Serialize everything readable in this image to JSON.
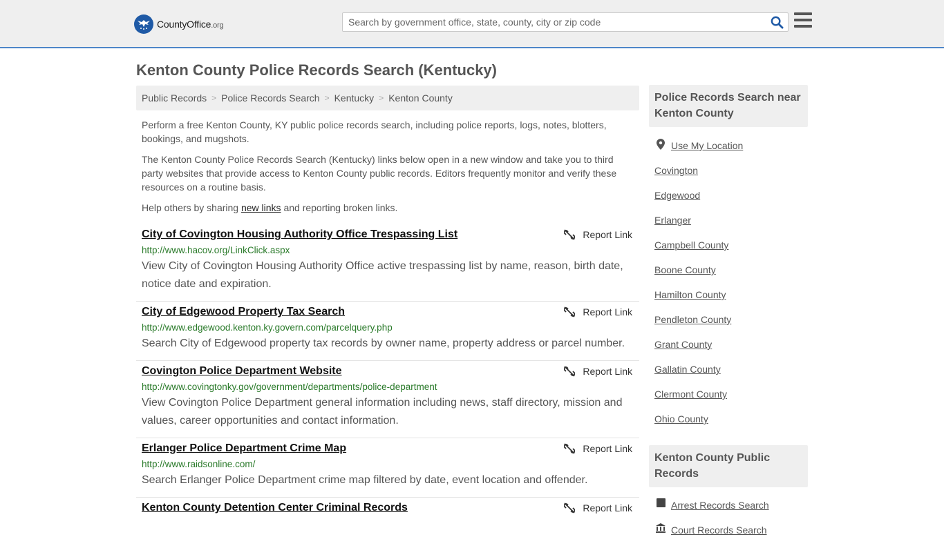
{
  "header": {
    "logo_text": "CountyOffice",
    "logo_suffix": ".org",
    "search_placeholder": "Search by government office, state, county, city or zip code"
  },
  "page": {
    "title": "Kenton County Police Records Search (Kentucky)"
  },
  "breadcrumb": [
    "Public Records",
    "Police Records Search",
    "Kentucky",
    "Kenton County"
  ],
  "intro": {
    "p1": "Perform a free Kenton County, KY public police records search, including police reports, logs, notes, blotters, bookings, and mugshots.",
    "p2": "The Kenton County Police Records Search (Kentucky) links below open in a new window and take you to third party websites that provide access to Kenton County public records. Editors frequently monitor and verify these resources on a routine basis.",
    "p3_before": "Help others by sharing ",
    "p3_link": "new links",
    "p3_after": " and reporting broken links."
  },
  "report_label": "Report Link",
  "entries": [
    {
      "title": "City of Covington Housing Authority Office Trespassing List",
      "url": "http://www.hacov.org/LinkClick.aspx",
      "desc": "View City of Covington Housing Authority Office active trespassing list by name, reason, birth date, notice date and expiration."
    },
    {
      "title": "City of Edgewood Property Tax Search",
      "url": "http://www.edgewood.kenton.ky.govern.com/parcelquery.php",
      "desc": "Search City of Edgewood property tax records by owner name, property address or parcel number."
    },
    {
      "title": "Covington Police Department Website",
      "url": "http://www.covingtonky.gov/government/departments/police-department",
      "desc": "View Covington Police Department general information including news, staff directory, mission and values, career opportunities and contact information."
    },
    {
      "title": "Erlanger Police Department Crime Map",
      "url": "http://www.raidsonline.com/",
      "desc": "Search Erlanger Police Department crime map filtered by date, event location and offender."
    },
    {
      "title": "Kenton County Detention Center Criminal Records",
      "url": "",
      "desc": ""
    }
  ],
  "sidebar": {
    "nearby_title": "Police Records Search near Kenton County",
    "use_location": "Use My Location",
    "nearby": [
      "Covington",
      "Edgewood",
      "Erlanger",
      "Campbell County",
      "Boone County",
      "Hamilton County",
      "Pendleton County",
      "Grant County",
      "Gallatin County",
      "Clermont County",
      "Ohio County"
    ],
    "public_records_title": "Kenton County Public Records",
    "public_records": [
      "Arrest Records Search",
      "Court Records Search"
    ]
  },
  "colors": {
    "accent": "#1f5aa6",
    "url_green": "#2a7a2a",
    "header_bg": "#efefef"
  }
}
